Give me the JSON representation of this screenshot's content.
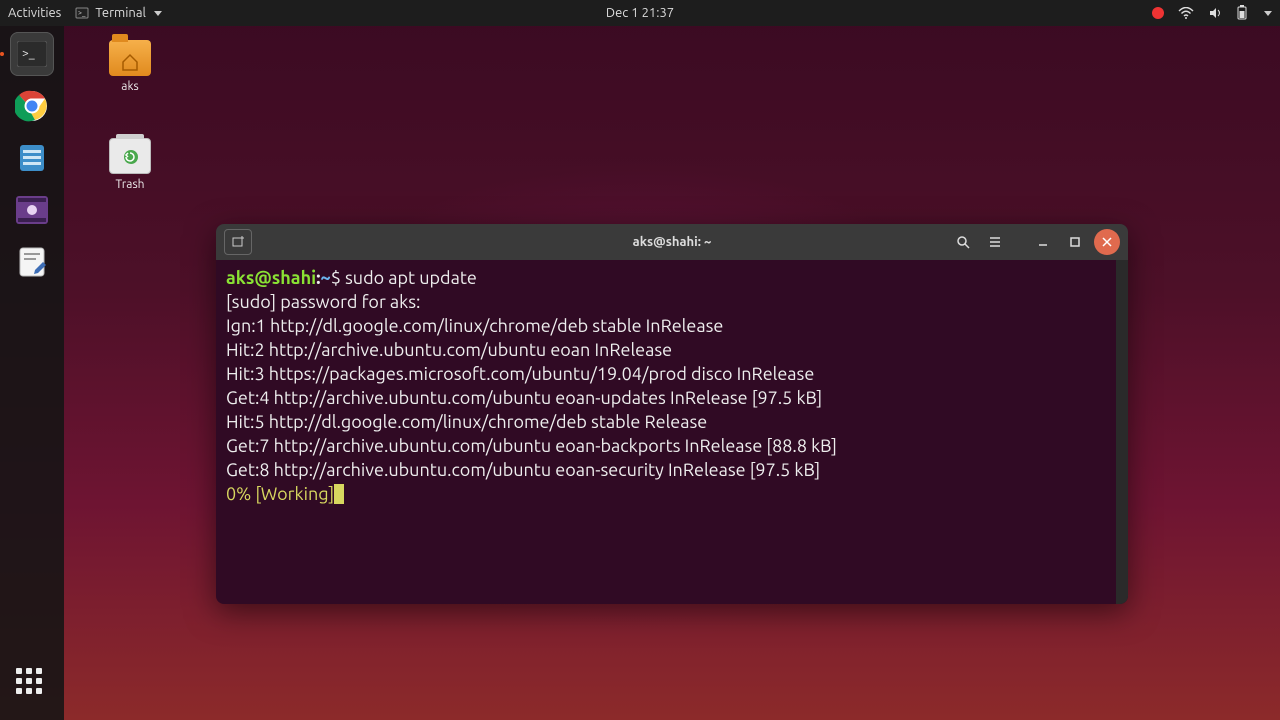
{
  "topbar": {
    "activities": "Activities",
    "app_name": "Terminal",
    "clock": "Dec 1  21:37"
  },
  "desktop": {
    "home_label": "aks",
    "trash_label": "Trash"
  },
  "terminal": {
    "title": "aks@shahi: ~",
    "prompt_user": "aks@shahi",
    "prompt_colon": ":",
    "prompt_path": "~",
    "prompt_dollar": "$ ",
    "command": "sudo apt update",
    "lines": [
      "[sudo] password for aks: ",
      "Ign:1 http://dl.google.com/linux/chrome/deb stable InRelease",
      "Hit:2 http://archive.ubuntu.com/ubuntu eoan InRelease",
      "Hit:3 https://packages.microsoft.com/ubuntu/19.04/prod disco InRelease",
      "Get:4 http://archive.ubuntu.com/ubuntu eoan-updates InRelease [97.5 kB]",
      "Hit:5 http://dl.google.com/linux/chrome/deb stable Release",
      "Get:7 http://archive.ubuntu.com/ubuntu eoan-backports InRelease [88.8 kB]",
      "Get:8 http://archive.ubuntu.com/ubuntu eoan-security InRelease [97.5 kB]"
    ],
    "progress": "0% [Working]"
  }
}
